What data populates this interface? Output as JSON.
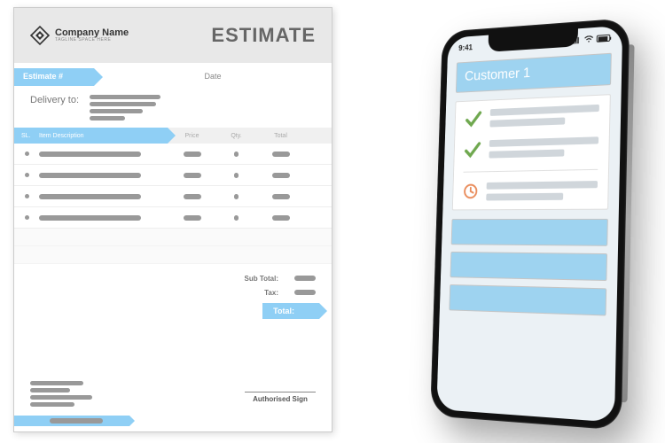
{
  "doc": {
    "company_name": "Company Name",
    "tagline": "TAGLINE SPACE HERE",
    "title": "ESTIMATE",
    "estimate_label": "Estimate #",
    "date_label": "Date",
    "delivery_label": "Delivery to:",
    "columns": {
      "sl": "SL.",
      "desc": "Item Description",
      "price": "Price",
      "qty": "Qty.",
      "total": "Total"
    },
    "subtotal_label": "Sub Total:",
    "tax_label": "Tax:",
    "total_label": "Total:",
    "sign_label": "Authorised Sign"
  },
  "phone": {
    "time": "9:41",
    "customer_title": "Customer 1"
  },
  "colors": {
    "accent": "#8fcff5",
    "check": "#6fa84f",
    "clock": "#e98b5a"
  }
}
